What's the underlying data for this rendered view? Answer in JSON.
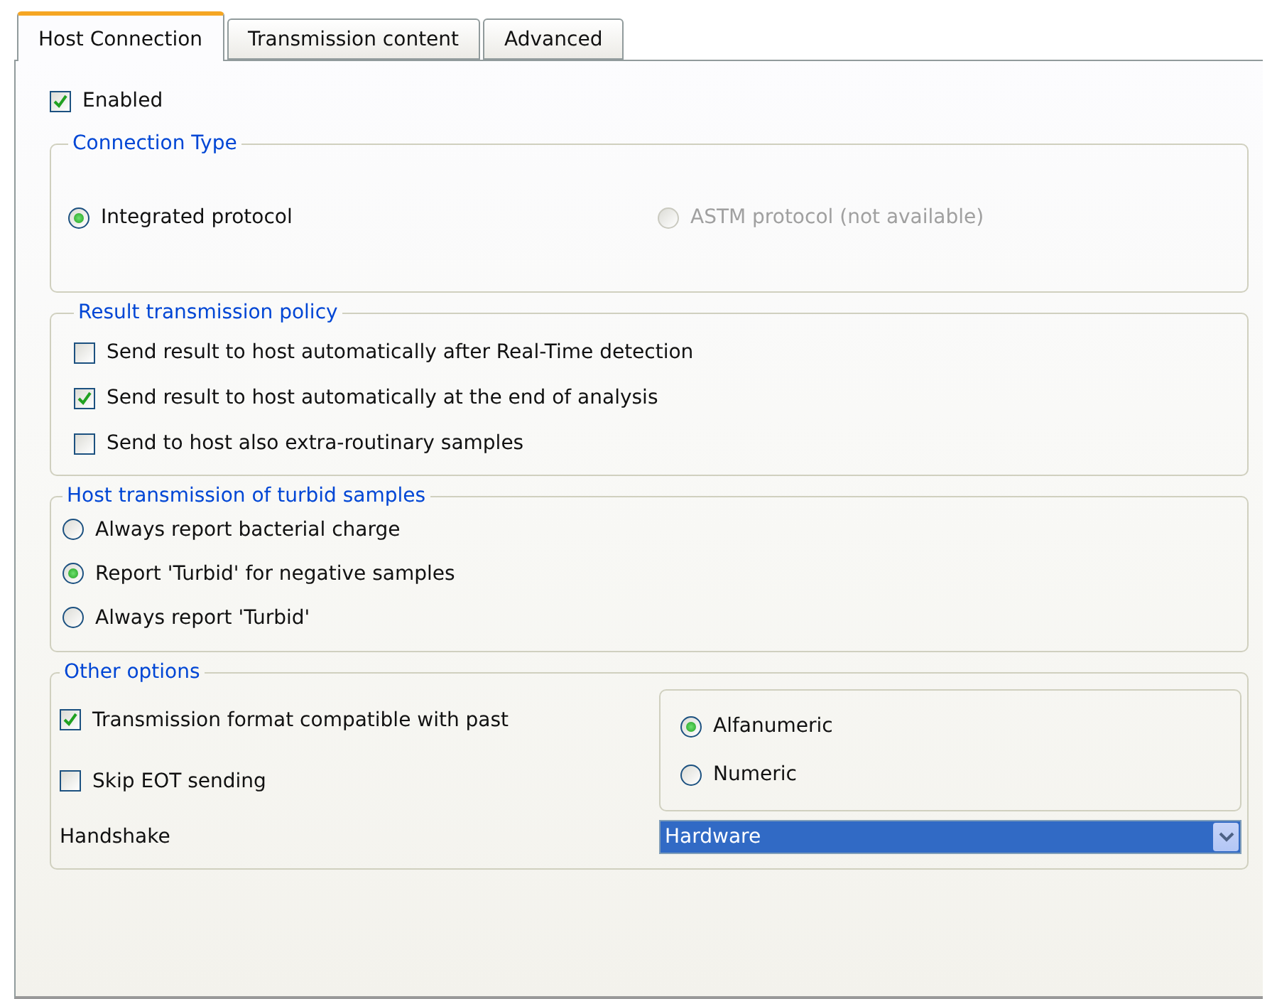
{
  "tabs": [
    {
      "label": "Host Connection",
      "selected": true
    },
    {
      "label": "Transmission content",
      "selected": false
    },
    {
      "label": "Advanced",
      "selected": false
    }
  ],
  "enabled": {
    "label": "Enabled",
    "checked": true
  },
  "connection_type": {
    "title": "Connection Type",
    "options": [
      {
        "label": "Integrated protocol",
        "selected": true,
        "disabled": false
      },
      {
        "label": "ASTM protocol (not available)",
        "selected": false,
        "disabled": true
      }
    ]
  },
  "result_policy": {
    "title": "Result transmission policy",
    "options": [
      {
        "label": "Send result to host automatically after Real-Time detection",
        "checked": false
      },
      {
        "label": "Send result to host automatically at the end of analysis",
        "checked": true
      },
      {
        "label": "Send to host also extra-routinary samples",
        "checked": false
      }
    ]
  },
  "turbid": {
    "title": "Host transmission of turbid samples",
    "options": [
      {
        "label": "Always report bacterial charge",
        "selected": false
      },
      {
        "label": "Report 'Turbid' for negative samples",
        "selected": true
      },
      {
        "label": "Always report 'Turbid'",
        "selected": false
      }
    ]
  },
  "other_options": {
    "title": "Other options",
    "checkboxes": [
      {
        "label": "Transmission format compatible with past",
        "checked": true
      },
      {
        "label": "Skip EOT sending",
        "checked": false
      }
    ],
    "format": [
      {
        "label": "Alfanumeric",
        "selected": true
      },
      {
        "label": "Numeric",
        "selected": false
      }
    ],
    "handshake": {
      "label": "Handshake",
      "value": "Hardware"
    }
  }
}
